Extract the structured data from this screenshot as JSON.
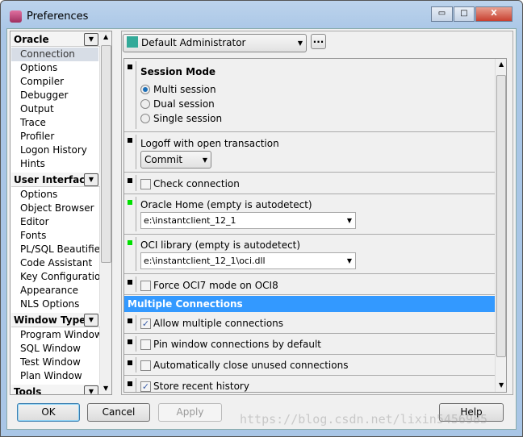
{
  "window": {
    "title": "Preferences",
    "minimize": "▭",
    "maximize": "□",
    "close": "X"
  },
  "sidebar": {
    "groups": [
      {
        "label": "Oracle",
        "items": [
          "Connection",
          "Options",
          "Compiler",
          "Debugger",
          "Output",
          "Trace",
          "Profiler",
          "Logon History",
          "Hints"
        ],
        "selected": "Connection"
      },
      {
        "label": "User Interface",
        "items": [
          "Options",
          "Object Browser",
          "Editor",
          "Fonts",
          "PL/SQL Beautifier",
          "Code Assistant",
          "Key Configuration",
          "Appearance",
          "NLS Options"
        ]
      },
      {
        "label": "Window Types",
        "items": [
          "Program Window",
          "SQL Window",
          "Test Window",
          "Plan Window"
        ]
      },
      {
        "label": "Tools",
        "items": []
      }
    ]
  },
  "profile": {
    "value": "Default Administrator",
    "more": "..."
  },
  "settings": {
    "session_mode": {
      "title": "Session Mode",
      "options": [
        "Multi session",
        "Dual session",
        "Single session"
      ],
      "selected": "Multi session"
    },
    "logoff": {
      "label": "Logoff with open transaction",
      "value": "Commit"
    },
    "check_connection": {
      "label": "Check connection",
      "checked": false
    },
    "oracle_home": {
      "label": "Oracle Home (empty is autodetect)",
      "value": "e:\\instantclient_12_1"
    },
    "oci_library": {
      "label": "OCI library (empty is autodetect)",
      "value": "e:\\instantclient_12_1\\oci.dll"
    },
    "force_oci7": {
      "label": "Force OCI7 mode on OCI8",
      "checked": false
    },
    "multiple_header": "Multiple Connections",
    "allow_multiple": {
      "label": "Allow multiple connections",
      "checked": true
    },
    "pin_window": {
      "label": "Pin window connections by default",
      "checked": false
    },
    "auto_close": {
      "label": "Automatically close unused connections",
      "checked": false
    },
    "store_history": {
      "label": "Store recent history",
      "checked": true
    }
  },
  "buttons": {
    "ok": "OK",
    "cancel": "Cancel",
    "apply": "Apply",
    "help": "Help"
  },
  "watermark": "https://blog.csdn.net/lixin5456985",
  "colors": {
    "accent": "#3399ff",
    "marker_green": "#00e000"
  }
}
